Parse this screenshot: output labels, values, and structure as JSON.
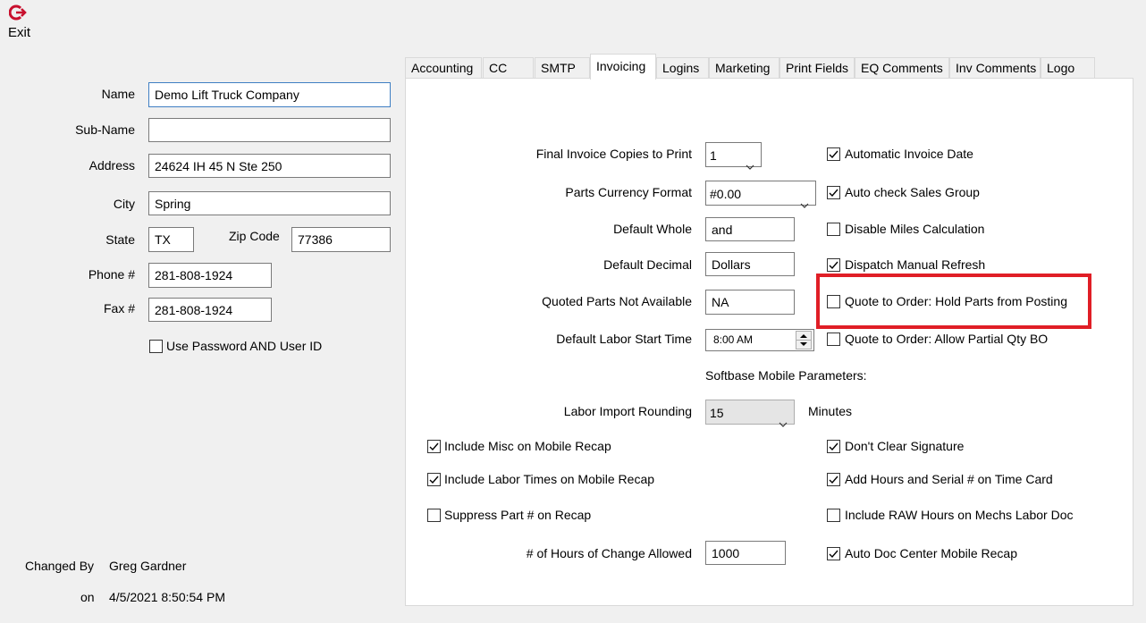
{
  "toolbar": {
    "exit_label": "Exit"
  },
  "company": {
    "name_label": "Name",
    "name_value": "Demo Lift Truck Company",
    "subname_label": "Sub-Name",
    "subname_value": "",
    "address_label": "Address",
    "address_value": "24624 IH 45 N Ste 250",
    "city_label": "City",
    "city_value": "Spring",
    "state_label": "State",
    "state_value": "TX",
    "zip_label": "Zip Code",
    "zip_value": "77386",
    "phone_label": "Phone #",
    "phone_value": "281-808-1924",
    "fax_label": "Fax #",
    "fax_value": "281-808-1924",
    "use_password_label": "Use Password AND User ID",
    "use_password_checked": false
  },
  "changed": {
    "by_label": "Changed By",
    "by_value": "Greg Gardner",
    "on_label": "on",
    "on_value": "4/5/2021 8:50:54 PM"
  },
  "tabs": [
    "Accounting",
    "CC",
    "SMTP",
    "Invoicing",
    "Logins",
    "Marketing",
    "Print Fields",
    "EQ Comments",
    "Inv Comments",
    "Logo"
  ],
  "active_tab": "Invoicing",
  "invoicing": {
    "final_copies_label": "Final Invoice Copies to Print",
    "final_copies_value": "1",
    "currency_label": "Parts Currency Format",
    "currency_value": "#0.00",
    "default_whole_label": "Default Whole",
    "default_whole_value": "and",
    "default_decimal_label": "Default Decimal",
    "default_decimal_value": "Dollars",
    "quoted_na_label": "Quoted Parts Not Available",
    "quoted_na_value": "NA",
    "labor_start_label": "Default Labor Start Time",
    "labor_start_value": "8:00 AM",
    "mobile_params_label": "Softbase Mobile Parameters:",
    "labor_rounding_label": "Labor Import Rounding",
    "labor_rounding_value": "15",
    "minutes_label": "Minutes",
    "hours_change_label": "# of Hours of Change Allowed",
    "hours_change_value": "1000",
    "right_checks": [
      {
        "label": "Automatic Invoice Date",
        "checked": true
      },
      {
        "label": "Auto check Sales Group",
        "checked": true
      },
      {
        "label": "Disable Miles Calculation",
        "checked": false
      },
      {
        "label": "Dispatch Manual Refresh",
        "checked": true
      },
      {
        "label": "Quote to Order: Hold Parts from Posting",
        "checked": false
      },
      {
        "label": "Quote to Order: Allow Partial Qty BO",
        "checked": false
      }
    ],
    "mobile_left_checks": [
      {
        "label": "Include Misc on Mobile Recap",
        "checked": true
      },
      {
        "label": "Include Labor Times on Mobile Recap",
        "checked": true
      },
      {
        "label": "Suppress Part # on Recap",
        "checked": false
      }
    ],
    "mobile_right_checks": [
      {
        "label": "Don't Clear Signature",
        "checked": true
      },
      {
        "label": "Add Hours and Serial # on Time Card",
        "checked": true
      },
      {
        "label": "Include RAW Hours on Mechs Labor Doc",
        "checked": false
      },
      {
        "label": "Auto Doc Center Mobile Recap",
        "checked": true
      }
    ]
  },
  "colors": {
    "highlight": "#e01e26",
    "exit_icon": "#c8102e"
  }
}
